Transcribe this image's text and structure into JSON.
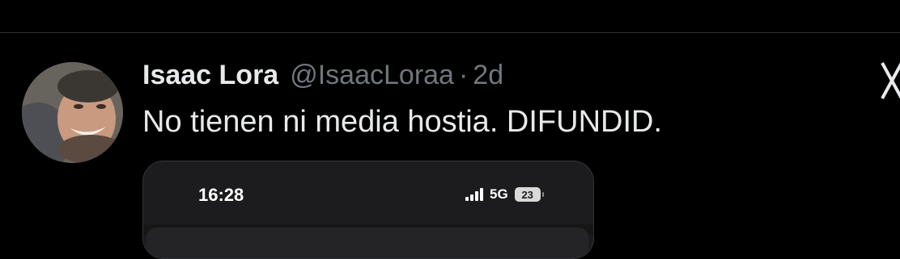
{
  "tweet": {
    "display_name": "Isaac Lora",
    "handle": "@IsaacLoraa",
    "separator": "·",
    "time": "2d",
    "text": "No tienen ni media hostia. DIFUNDID."
  },
  "media": {
    "status_bar": {
      "time": "16:28",
      "network": "5G",
      "battery": "23",
      "signal_icon": "cellular-signal-icon"
    }
  },
  "icons": {
    "close": "close-icon",
    "avatar": "avatar"
  },
  "colors": {
    "background": "#000000",
    "primary_text": "#e7e9ea",
    "secondary_text": "#71767b",
    "divider": "#2f3336"
  }
}
